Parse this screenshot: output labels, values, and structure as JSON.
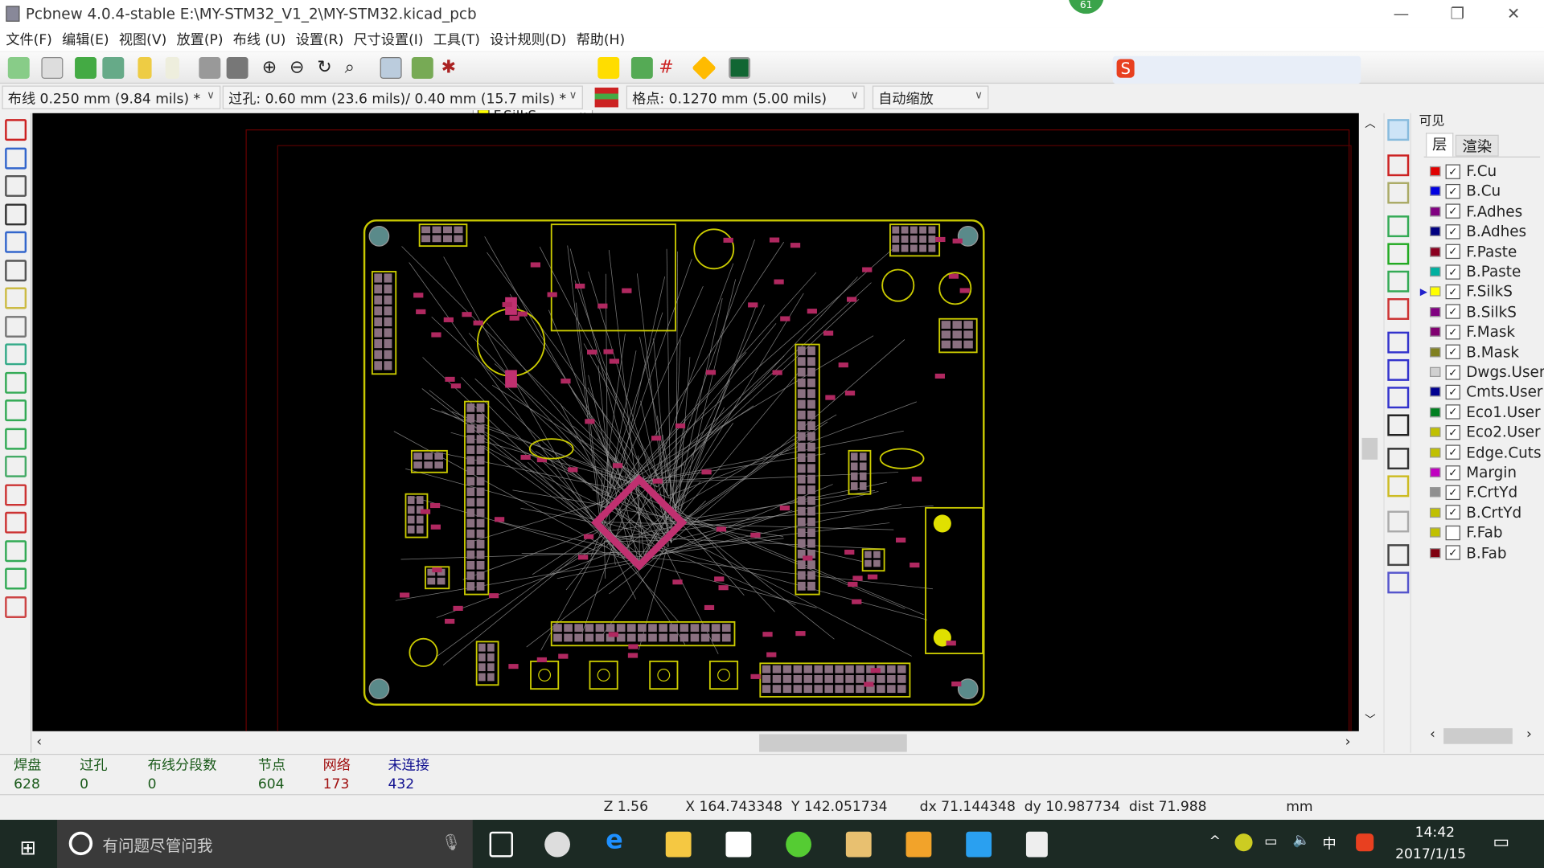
{
  "window": {
    "title": "Pcbnew 4.0.4-stable E:\\MY-STM32_V1_2\\MY-STM32.kicad_pcb",
    "badge": "61"
  },
  "menu": [
    "文件(F)",
    "编辑(E)",
    "视图(V)",
    "放置(P)",
    "布线 (U)",
    "设置(R)",
    "尺寸设置(I)",
    "工具(T)",
    "设计规则(D)",
    "帮助(H)"
  ],
  "toolbar": {
    "active_layer": "F.SilkS",
    "active_layer_color": "#ffff00"
  },
  "options": {
    "track_width": "布线 0.250 mm (9.84 mils) *",
    "via_size": "过孔: 0.60 mm (23.6 mils)/ 0.40 mm (15.7 mils) *",
    "grid": "格点: 0.1270 mm (5.00 mils)",
    "zoom": "自动缩放"
  },
  "panel": {
    "title": "可见",
    "tabs": [
      "层",
      "渲染"
    ],
    "active_tab": "层",
    "layers": [
      {
        "name": "F.Cu",
        "color": "#e00000",
        "checked": true
      },
      {
        "name": "B.Cu",
        "color": "#0000e0",
        "checked": true
      },
      {
        "name": "F.Adhes",
        "color": "#800080",
        "checked": true
      },
      {
        "name": "B.Adhes",
        "color": "#000080",
        "checked": true
      },
      {
        "name": "F.Paste",
        "color": "#8b0020",
        "checked": true
      },
      {
        "name": "B.Paste",
        "color": "#00b0a0",
        "checked": true
      },
      {
        "name": "F.SilkS",
        "color": "#ffff00",
        "checked": true,
        "active": true
      },
      {
        "name": "B.SilkS",
        "color": "#800080",
        "checked": true
      },
      {
        "name": "F.Mask",
        "color": "#800070",
        "checked": true
      },
      {
        "name": "B.Mask",
        "color": "#808020",
        "checked": true
      },
      {
        "name": "Dwgs.User",
        "color": "#d0d0d0",
        "checked": true
      },
      {
        "name": "Cmts.User",
        "color": "#000090",
        "checked": true
      },
      {
        "name": "Eco1.User",
        "color": "#008020",
        "checked": true
      },
      {
        "name": "Eco2.User",
        "color": "#c0c000",
        "checked": true
      },
      {
        "name": "Edge.Cuts",
        "color": "#c0c000",
        "checked": true
      },
      {
        "name": "Margin",
        "color": "#c000c0",
        "checked": true
      },
      {
        "name": "F.CrtYd",
        "color": "#909090",
        "checked": true
      },
      {
        "name": "B.CrtYd",
        "color": "#c0c000",
        "checked": true
      },
      {
        "name": "F.Fab",
        "color": "#c0c000",
        "checked": false
      },
      {
        "name": "B.Fab",
        "color": "#800010",
        "checked": true
      }
    ]
  },
  "stats": [
    {
      "label": "焊盘",
      "value": "628",
      "color": "#1a5a1a"
    },
    {
      "label": "过孔",
      "value": "0",
      "color": "#1a5a1a"
    },
    {
      "label": "布线分段数",
      "value": "0",
      "color": "#1a5a1a"
    },
    {
      "label": "节点",
      "value": "604",
      "color": "#1a5a1a"
    },
    {
      "label": "网络",
      "value": "173",
      "color": "#a01010"
    },
    {
      "label": "未连接",
      "value": "432",
      "color": "#101090"
    }
  ],
  "status": {
    "zoom": "Z 1.56",
    "xy": "X 164.743348  Y 142.051734",
    "delta": "dx 71.144348  dy 10.987734  dist 71.988",
    "units": "mm"
  },
  "taskbar": {
    "search_placeholder": "有问题尽管问我",
    "time": "14:42",
    "date": "2017/1/15",
    "ime": "中"
  }
}
